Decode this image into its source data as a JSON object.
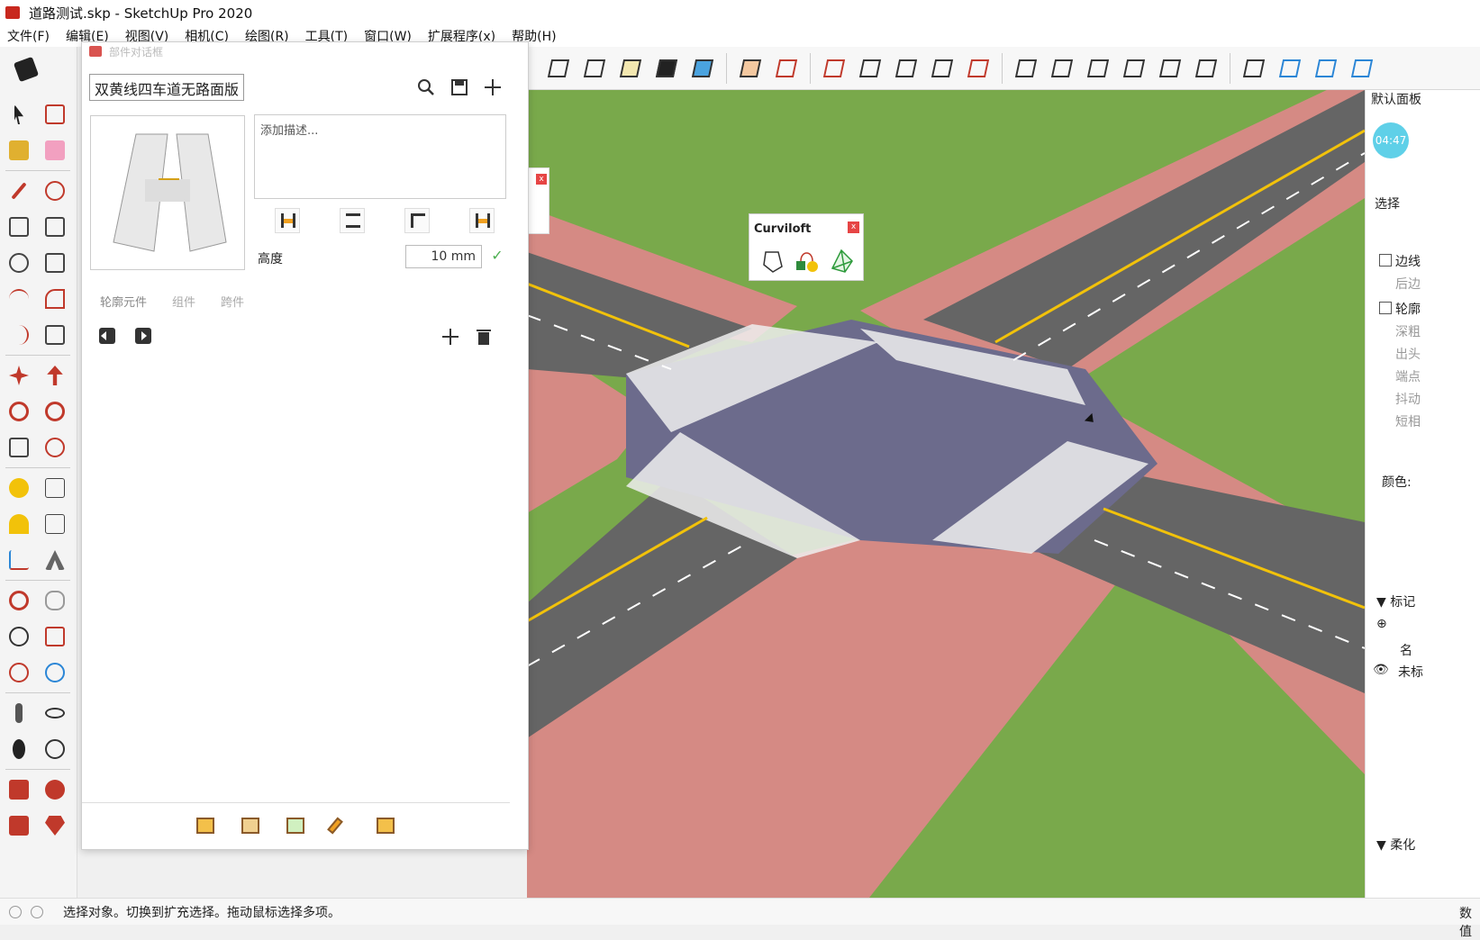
{
  "window": {
    "title": "道路测试.skp - SketchUp Pro 2020"
  },
  "menu": [
    "文件(F)",
    "编辑(E)",
    "视图(V)",
    "相机(C)",
    "绘图(R)",
    "工具(T)",
    "窗口(W)",
    "扩展程序(x)",
    "帮助(H)"
  ],
  "top_toolbar": {
    "icons": [
      "box-icon",
      "face-icon",
      "cube-icon",
      "layers-icon",
      "paint-icon",
      "sandbox-icon",
      "grid-icon",
      "section-icon",
      "terrain-icon",
      "mesh-icon",
      "map-icon",
      "split-icon",
      "house-icon",
      "door-icon",
      "home-icon",
      "roof-icon",
      "house-outline-icon",
      "garage-icon",
      "axis-icon",
      "cube-blue-icon",
      "cube-blue2-icon",
      "cube-blue3-icon"
    ]
  },
  "left_toolbar": {
    "icons": [
      "select-icon",
      "component-icon",
      "paint-bucket-icon",
      "eraser-icon",
      "pencil-icon",
      "freehand-icon",
      "rectangle-icon",
      "rotated-rect-icon",
      "circle-icon",
      "polygon-icon",
      "arc-icon",
      "pie-icon",
      "arc2-icon",
      "arc3-icon",
      "move-icon",
      "push-pull-icon",
      "rotate-icon",
      "follow-me-icon",
      "scale-icon",
      "offset-icon",
      "tape-measure-icon",
      "dimension-icon",
      "protractor-icon",
      "text-icon",
      "axes-icon",
      "3d-text-icon",
      "orbit-icon",
      "pan-icon",
      "zoom-icon",
      "zoom-window-icon",
      "zoom-extents-icon",
      "previous-view-icon",
      "position-camera-icon",
      "look-around-icon",
      "walk-icon",
      "section-plane-icon",
      "warehouse-icon",
      "extension-icon",
      "send-layout-icon",
      "ruby-icon"
    ]
  },
  "panel": {
    "title": "部件对话框",
    "name_value": "双黄线四车道无路面版",
    "description_placeholder": "添加描述...",
    "height_label": "高度",
    "height_value": "10 mm",
    "tabs": [
      "轮廓元件",
      "组件",
      "跨件"
    ]
  },
  "curviloft": {
    "title": "Curviloft"
  },
  "right_panel": {
    "tray_title": "默认面板",
    "clock": "04:47",
    "select_label": "选择",
    "edges_label": "边线",
    "back_label": "后边",
    "profiles_label": "轮廓",
    "depth_label": "深粗",
    "extension_label": "出头",
    "endpoints_label": "端点",
    "jitter_label": "抖动",
    "short_label": "短相",
    "color_label": "颜色:",
    "tags_label": "▼ 标记",
    "name_header": "名",
    "untagged": "未标",
    "soften_label": "▼ 柔化"
  },
  "statusbar": {
    "message": "选择对象。切换到扩充选择。拖动鼠标选择多项。",
    "right_label": "数值"
  },
  "colors": {
    "grass": "#79a94b",
    "sidewalk": "#d58a84",
    "asphalt": "#656565",
    "plaza": "#6c6b8c",
    "yellow_line": "#f2c20a"
  }
}
